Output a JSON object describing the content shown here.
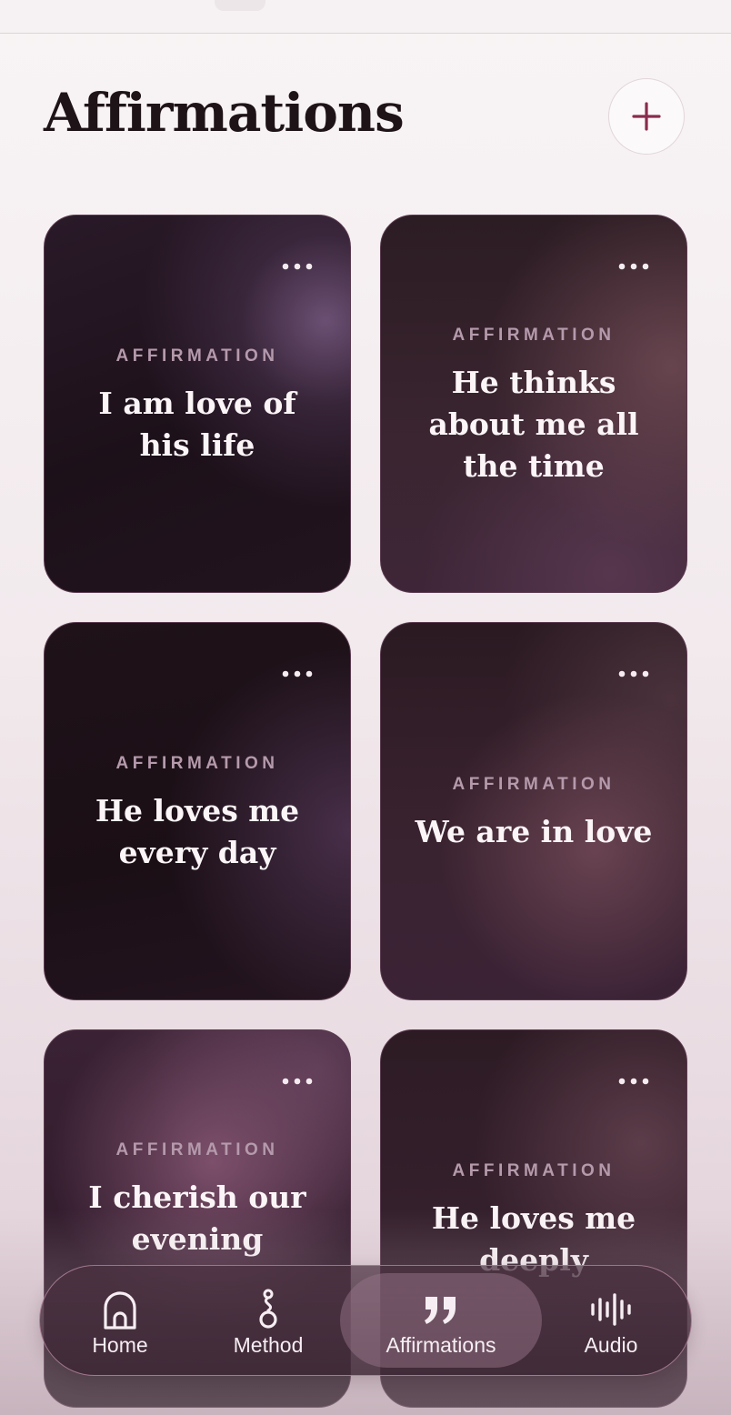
{
  "header": {
    "title": "Affirmations",
    "add_icon": "plus-icon"
  },
  "cards": [
    {
      "label": "AFFIRMATION",
      "text": "I am love of his life"
    },
    {
      "label": "AFFIRMATION",
      "text": "He thinks about me all the time"
    },
    {
      "label": "AFFIRMATION",
      "text": "He loves me every day"
    },
    {
      "label": "AFFIRMATION",
      "text": "We are in love"
    },
    {
      "label": "AFFIRMATION",
      "text": "I cherish our evening"
    },
    {
      "label": "AFFIRMATION",
      "text": "He loves me deeply"
    }
  ],
  "tabbar": {
    "active": "Affirmations",
    "tabs": [
      {
        "label": "Home",
        "icon": "home-arch-icon"
      },
      {
        "label": "Method",
        "icon": "method-icon"
      },
      {
        "label": "Affirmations",
        "icon": "quote-icon"
      },
      {
        "label": "Audio",
        "icon": "audio-waveform-icon"
      }
    ]
  },
  "colors": {
    "accent": "#8a2c4e",
    "card_dark": "#1c1019",
    "tabbar_bg": "#3a2432"
  }
}
